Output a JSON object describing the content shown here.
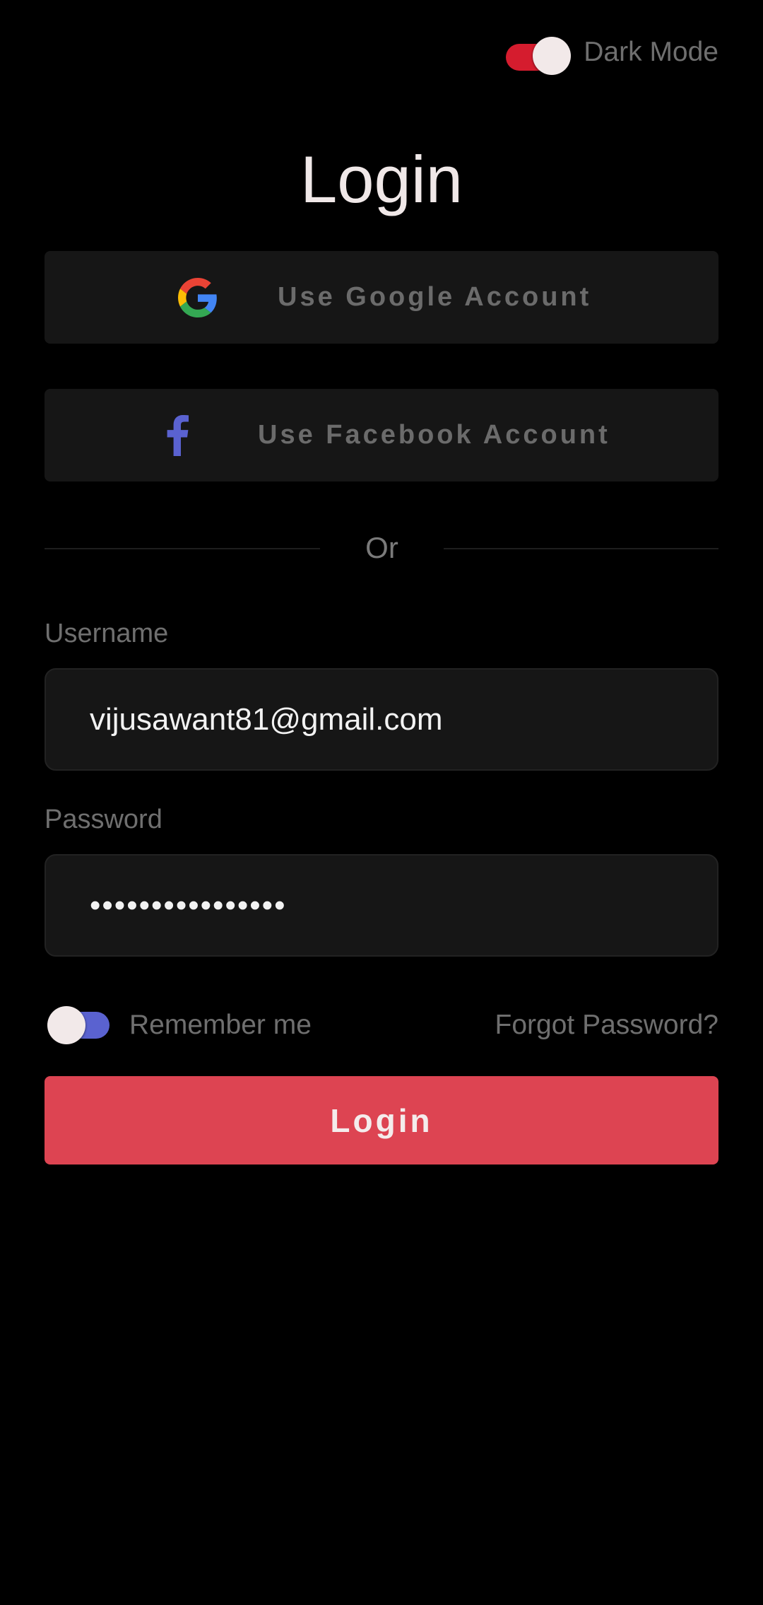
{
  "colors": {
    "background": "#000000",
    "surface": "#161616",
    "accent_red": "#dd4452",
    "dark_toggle_track": "#d51c2e",
    "remember_toggle_track": "#5a62d0",
    "facebook_blue": "#5a62d0",
    "muted_text": "#6f6f6f",
    "bright_text": "#f2f2f2"
  },
  "header": {
    "dark_mode_toggle": {
      "state": "on",
      "label": "Dark Mode"
    }
  },
  "title": "Login",
  "social": {
    "google": {
      "icon": "google-icon",
      "label": "Use Google Account"
    },
    "facebook": {
      "icon": "facebook-icon",
      "label": "Use Facebook Account"
    }
  },
  "divider": {
    "text": "Or"
  },
  "form": {
    "username": {
      "label": "Username",
      "value": "vijusawant81@gmail.com"
    },
    "password": {
      "label": "Password",
      "value": "••••••••••••••••"
    },
    "remember_me": {
      "state": "off",
      "label": "Remember me"
    },
    "forgot_password": "Forgot Password?",
    "submit_label": "Login"
  }
}
